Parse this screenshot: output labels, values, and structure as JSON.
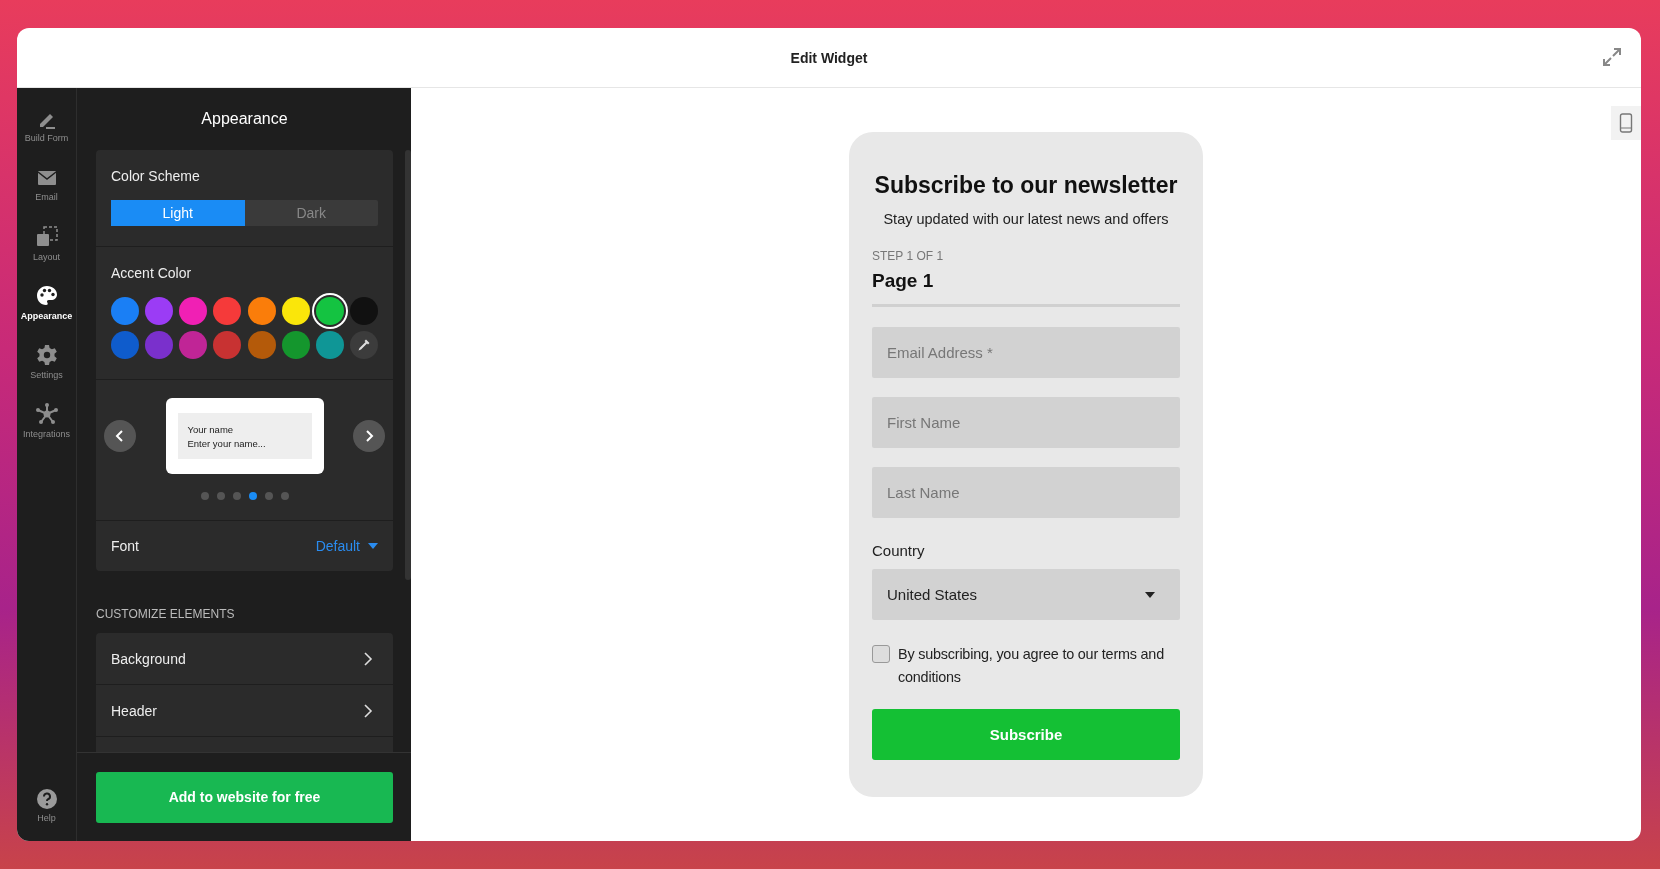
{
  "window": {
    "title": "Edit Widget"
  },
  "nav": [
    {
      "label": "Build Form",
      "selected": false
    },
    {
      "label": "Email",
      "selected": false
    },
    {
      "label": "Layout",
      "selected": false
    },
    {
      "label": "Appearance",
      "selected": true
    },
    {
      "label": "Settings",
      "selected": false
    },
    {
      "label": "Integrations",
      "selected": false
    }
  ],
  "help": {
    "label": "Help"
  },
  "panel": {
    "title": "Appearance",
    "color_scheme": {
      "label": "Color Scheme",
      "options": [
        {
          "label": "Light",
          "selected": true
        },
        {
          "label": "Dark",
          "selected": false
        }
      ]
    },
    "accent": {
      "label": "Accent Color",
      "swatches": [
        {
          "kind": "color",
          "color": "#1a7ff5",
          "selected": false
        },
        {
          "kind": "color",
          "color": "#9b3cf5",
          "selected": false
        },
        {
          "kind": "color",
          "color": "#f020b4",
          "selected": false
        },
        {
          "kind": "color",
          "color": "#f53a3a",
          "selected": false
        },
        {
          "kind": "color",
          "color": "#fa7d0a",
          "selected": false
        },
        {
          "kind": "color",
          "color": "#fae60a",
          "selected": false
        },
        {
          "kind": "color",
          "color": "#14c341",
          "selected": true
        },
        {
          "kind": "color",
          "color": "#111111",
          "selected": false
        },
        {
          "kind": "color",
          "color": "#0f5ccc",
          "selected": false
        },
        {
          "kind": "color",
          "color": "#7a30cc",
          "selected": false
        },
        {
          "kind": "color",
          "color": "#c02596",
          "selected": false
        },
        {
          "kind": "color",
          "color": "#c83232",
          "selected": false
        },
        {
          "kind": "color",
          "color": "#b45a0a",
          "selected": false
        },
        {
          "kind": "color",
          "color": "#14962d",
          "selected": false
        },
        {
          "kind": "color",
          "color": "#0f9696",
          "selected": false
        },
        {
          "kind": "picker"
        }
      ]
    },
    "carousel": {
      "preview_label": "Your name",
      "preview_placeholder": "Enter your name...",
      "dots": [
        {
          "selected": false
        },
        {
          "selected": false
        },
        {
          "selected": false
        },
        {
          "selected": true
        },
        {
          "selected": false
        },
        {
          "selected": false
        }
      ]
    },
    "font": {
      "label": "Font",
      "value": "Default"
    },
    "customize": {
      "heading": "CUSTOMIZE ELEMENTS",
      "items": [
        {
          "label": "Background"
        },
        {
          "label": "Header"
        }
      ]
    },
    "cta": "Add to website for free"
  },
  "form": {
    "title": "Subscribe to our newsletter",
    "subtitle": "Stay updated with our latest news and offers",
    "step": "STEP 1 OF 1",
    "page": "Page 1",
    "progress": {
      "level": 1
    },
    "fields": [
      {
        "placeholder": "Email Address *"
      },
      {
        "placeholder": "First Name"
      },
      {
        "placeholder": "Last Name"
      }
    ],
    "country": {
      "label": "Country",
      "value": "United States"
    },
    "consent": {
      "label": "By subscribing, you agree to our terms and conditions",
      "checked": false
    },
    "button": "Subscribe"
  }
}
